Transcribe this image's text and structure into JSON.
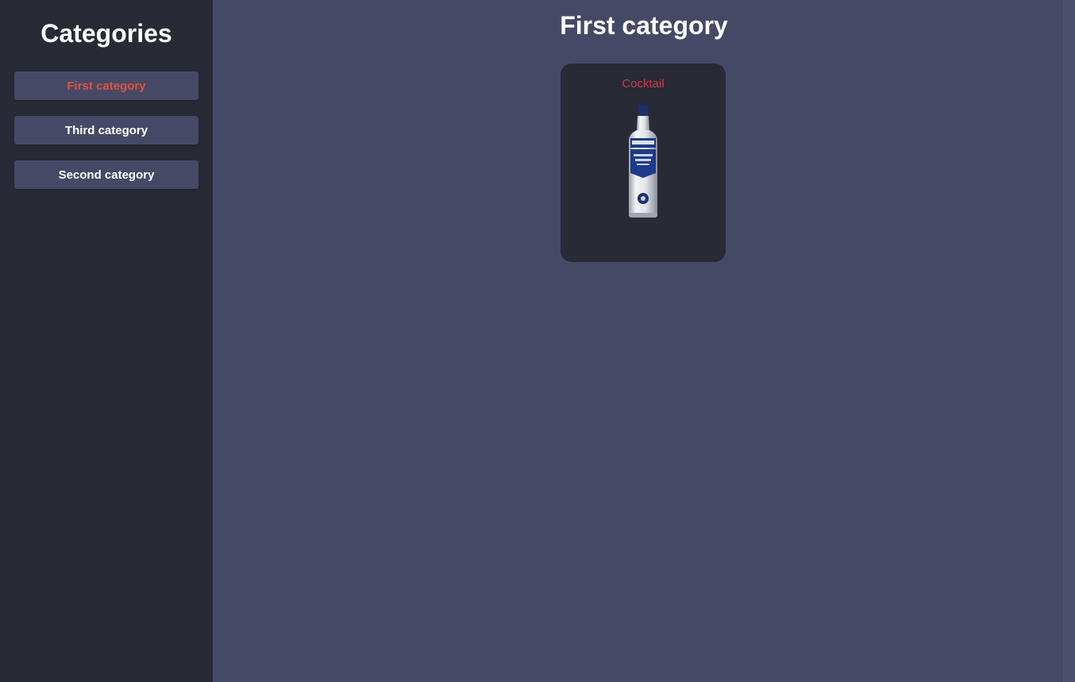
{
  "sidebar": {
    "title": "Categories",
    "items": [
      {
        "label": "First category",
        "active": true
      },
      {
        "label": "Third category",
        "active": false
      },
      {
        "label": "Second category",
        "active": false
      }
    ]
  },
  "main": {
    "title": "First category",
    "cards": [
      {
        "title": "Cocktail",
        "image_icon": "gin-bottle-icon"
      }
    ]
  },
  "colors": {
    "sidebar_bg": "#282a36",
    "main_bg": "#464966",
    "button_bg": "#464966",
    "active_text": "#e0523e",
    "card_bg": "#282a36",
    "card_title": "#d23a4a"
  }
}
